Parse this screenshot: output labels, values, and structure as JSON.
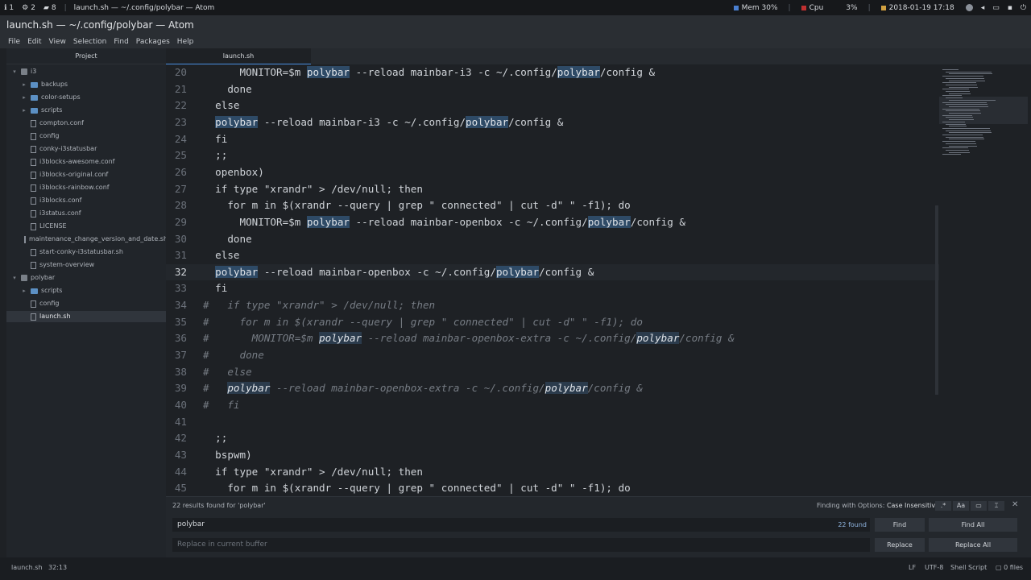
{
  "sysbar": {
    "ws1": "1",
    "ws2": "2",
    "ws3": "8",
    "title": "launch.sh — ~/.config/polybar — Atom",
    "mem_label": "Mem 30%",
    "cpu_label": "Cpu",
    "cpu_value": "3%",
    "datetime": "2018-01-19 17:18"
  },
  "window": {
    "title": "launch.sh — ~/.config/polybar — Atom"
  },
  "menu": [
    "File",
    "Edit",
    "View",
    "Selection",
    "Find",
    "Packages",
    "Help"
  ],
  "sidebar": {
    "header": "Project",
    "items": [
      {
        "label": "i3",
        "kind": "repo",
        "arrow": "▾"
      },
      {
        "label": "backups",
        "kind": "folder",
        "arrow": "▸"
      },
      {
        "label": "color-setups",
        "kind": "folder",
        "arrow": "▸"
      },
      {
        "label": "scripts",
        "kind": "folder",
        "arrow": "▸"
      },
      {
        "label": "compton.conf",
        "kind": "file"
      },
      {
        "label": "config",
        "kind": "file"
      },
      {
        "label": "conky-i3statusbar",
        "kind": "file"
      },
      {
        "label": "i3blocks-awesome.conf",
        "kind": "file"
      },
      {
        "label": "i3blocks-original.conf",
        "kind": "file"
      },
      {
        "label": "i3blocks-rainbow.conf",
        "kind": "file"
      },
      {
        "label": "i3blocks.conf",
        "kind": "file"
      },
      {
        "label": "i3status.conf",
        "kind": "file"
      },
      {
        "label": "LICENSE",
        "kind": "file"
      },
      {
        "label": "maintenance_change_version_and_date.sh",
        "kind": "file"
      },
      {
        "label": "start-conky-i3statusbar.sh",
        "kind": "file"
      },
      {
        "label": "system-overview",
        "kind": "file"
      },
      {
        "label": "polybar",
        "kind": "repo",
        "arrow": "▾"
      },
      {
        "label": "scripts",
        "kind": "folder",
        "arrow": "▸"
      },
      {
        "label": "config",
        "kind": "file"
      },
      {
        "label": "launch.sh",
        "kind": "file",
        "selected": true
      }
    ]
  },
  "tab": {
    "label": "launch.sh"
  },
  "editor": {
    "search_term": "polybar",
    "current_line": 32,
    "lines": [
      {
        "n": "20",
        "text": "      MONITOR=$m polybar --reload mainbar-i3 -c ~/.config/polybar/config &"
      },
      {
        "n": "21",
        "text": "    done"
      },
      {
        "n": "22",
        "text": "  else"
      },
      {
        "n": "23",
        "text": "  polybar --reload mainbar-i3 -c ~/.config/polybar/config &"
      },
      {
        "n": "24",
        "text": "  fi"
      },
      {
        "n": "25",
        "text": "  ;;"
      },
      {
        "n": "26",
        "text": "  openbox)"
      },
      {
        "n": "27",
        "text": "  if type \"xrandr\" > /dev/null; then"
      },
      {
        "n": "28",
        "text": "    for m in $(xrandr --query | grep \" connected\" | cut -d\" \" -f1); do"
      },
      {
        "n": "29",
        "text": "      MONITOR=$m polybar --reload mainbar-openbox -c ~/.config/polybar/config &"
      },
      {
        "n": "30",
        "text": "    done"
      },
      {
        "n": "31",
        "text": "  else"
      },
      {
        "n": "32",
        "text": "  polybar --reload mainbar-openbox -c ~/.config/polybar/config &"
      },
      {
        "n": "33",
        "text": "  fi"
      },
      {
        "n": "34",
        "text": "#   if type \"xrandr\" > /dev/null; then",
        "comment": true
      },
      {
        "n": "35",
        "text": "#     for m in $(xrandr --query | grep \" connected\" | cut -d\" \" -f1); do",
        "comment": true
      },
      {
        "n": "36",
        "text": "#       MONITOR=$m polybar --reload mainbar-openbox-extra -c ~/.config/polybar/config &",
        "comment": true
      },
      {
        "n": "37",
        "text": "#     done",
        "comment": true
      },
      {
        "n": "38",
        "text": "#   else",
        "comment": true
      },
      {
        "n": "39",
        "text": "#   polybar --reload mainbar-openbox-extra -c ~/.config/polybar/config &",
        "comment": true
      },
      {
        "n": "40",
        "text": "#   fi",
        "comment": true
      },
      {
        "n": "41",
        "text": ""
      },
      {
        "n": "42",
        "text": "  ;;"
      },
      {
        "n": "43",
        "text": "  bspwm)"
      },
      {
        "n": "44",
        "text": "  if type \"xrandr\" > /dev/null; then"
      },
      {
        "n": "45",
        "text": "    for m in $(xrandr --query | grep \" connected\" | cut -d\" \" -f1); do"
      }
    ]
  },
  "find": {
    "results_label": "22 results found for 'polybar'",
    "options_prefix": "Finding with Options:",
    "options_value": "Case Insensitive",
    "find_value": "polybar",
    "found_count": "22 found",
    "replace_placeholder": "Replace in current buffer",
    "find_button": "Find",
    "find_all_button": "Find All",
    "replace_button": "Replace",
    "replace_all_button": "Replace All",
    "opt_regex": ".*",
    "opt_case": "Aa",
    "opt_selection": "▭",
    "opt_word": "⌶"
  },
  "status": {
    "file": "launch.sh",
    "cursor": "32:13",
    "line_ending": "LF",
    "encoding": "UTF-8",
    "grammar": "Shell Script",
    "files": "0 files"
  }
}
